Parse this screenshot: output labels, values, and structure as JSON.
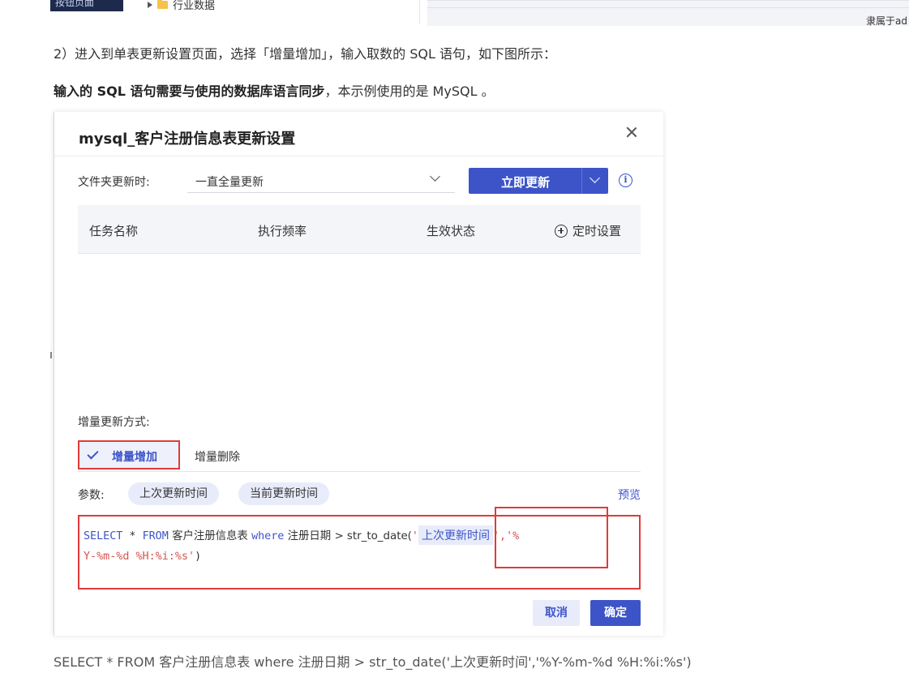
{
  "top": {
    "left_panel_label": "按钮页面",
    "tree_item": "行业数据",
    "right_text": "隶属于ad"
  },
  "doc": {
    "step2": "2）进入到单表更新设置页面，选择「增量增加」，输入取数的 SQL 语句，如下图所示：",
    "note_bold": "输入的 SQL 语句需要与使用的数据库语言同步",
    "note_rest": "，本示例使用的是 MySQL 。",
    "code_caption": "SELECT * FROM 客户注册信息表 where 注册日期 > str_to_date('上次更新时间','%Y-%m-%d %H:%i:%s')"
  },
  "dialog": {
    "title": "mysql_客户注册信息表更新设置",
    "folder_update_label": "文件夹更新时:",
    "folder_update_value": "一直全量更新",
    "update_now": "立即更新",
    "info_glyph": "i",
    "table": {
      "headers": [
        "任务名称",
        "执行频率",
        "生效状态"
      ],
      "schedule_setting": "定时设置",
      "rows": []
    },
    "incremental_label": "增量更新方式:",
    "tabs": [
      {
        "label": "增量增加",
        "selected": true
      },
      {
        "label": "增量删除",
        "selected": false
      }
    ],
    "params_label": "参数:",
    "params": [
      "上次更新时间",
      "当前更新时间"
    ],
    "preview": "预览",
    "sql": {
      "select": "SELECT",
      "star": " * ",
      "from": "FROM",
      "table": " 客户注册信息表 ",
      "where": "where",
      "cond": " 注册日期 > str_to_date(",
      "q1": "'",
      "param": "上次更新时间",
      "q2": "',",
      "fmt1": "'%",
      "fmt2": "Y-%m-%d %H:%i:%s'",
      "close": ")"
    },
    "cancel": "取消",
    "ok": "确定"
  },
  "colors": {
    "accent": "#3d54c8",
    "highlight_border": "#e03a3a",
    "chip_bg": "#e8ecfa"
  }
}
